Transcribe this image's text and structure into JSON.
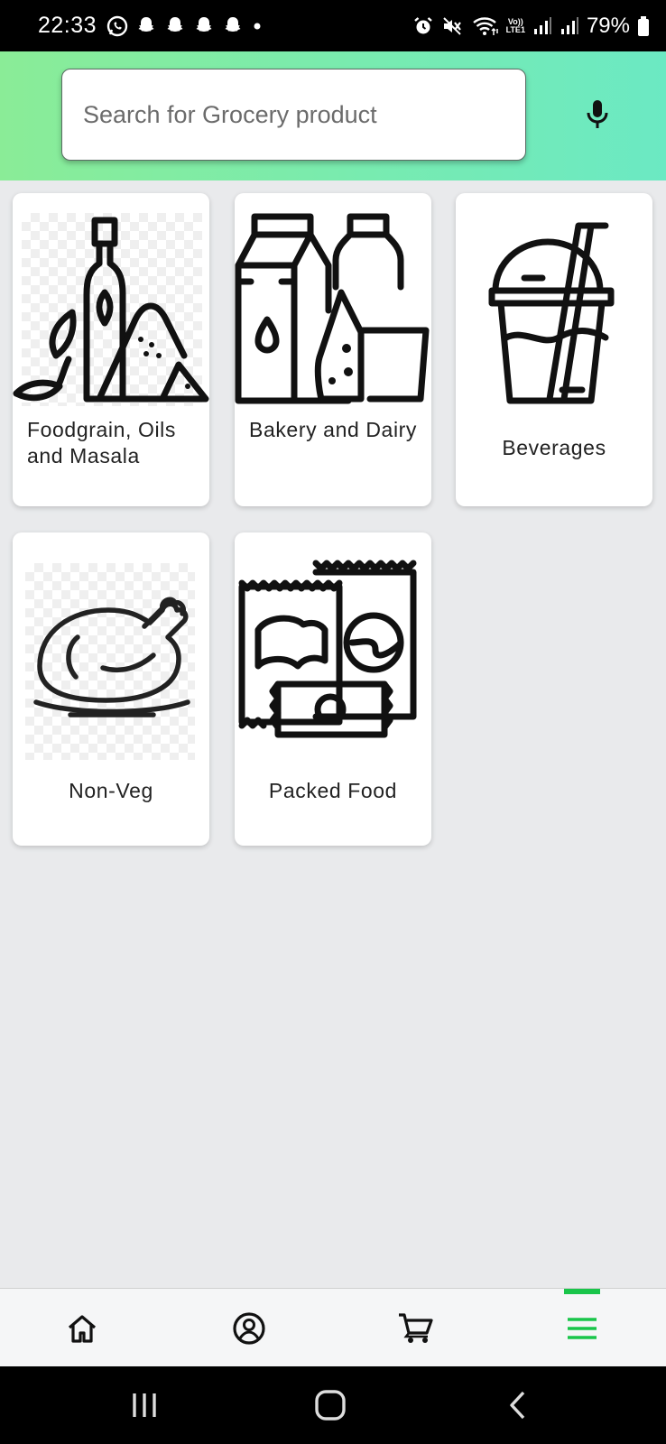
{
  "status_bar": {
    "time": "22:33",
    "battery": "79%",
    "network_label_top": "Vo))",
    "network_label_bottom": "LTE1"
  },
  "search": {
    "placeholder": "Search for Grocery product",
    "mic_icon": "microphone-icon"
  },
  "categories": [
    {
      "label": "Foodgrain, Oils and Masala",
      "icon": "oil-grain-icon"
    },
    {
      "label": "Bakery and Dairy",
      "icon": "milk-cheese-icon"
    },
    {
      "label": "Beverages",
      "icon": "drink-cup-icon"
    },
    {
      "label": "Non-Veg",
      "icon": "roast-chicken-icon"
    },
    {
      "label": "Packed Food",
      "icon": "snack-packets-icon"
    }
  ],
  "bottom_nav": {
    "items": [
      "home-icon",
      "profile-icon",
      "cart-icon",
      "menu-icon"
    ],
    "active": "menu-icon",
    "accent_color": "#19c54a"
  },
  "colors": {
    "header_gradient_start": "#8aec97",
    "header_gradient_end": "#6be9c3",
    "background": "#e9eaec"
  }
}
